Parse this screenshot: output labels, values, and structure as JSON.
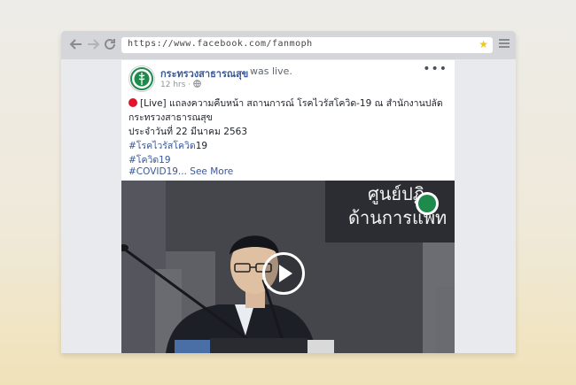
{
  "browser": {
    "url": "https://www.facebook.com/fanmoph",
    "icons": [
      "back-arrow-icon",
      "forward-arrow-icon",
      "reload-icon",
      "bookmark-star-icon",
      "menu-icon"
    ],
    "star_color": "#f2c811"
  },
  "post": {
    "page_name": "กระทรวงสาธารณสุข",
    "status_text": "was live.",
    "time": "12 hrs",
    "more_glyph": "•••",
    "live_prefix": "[Live]",
    "line1_rest": " แถลงความคืบหน้า สถานการณ์ โรคไวรัสโควิด-19 ณ สำนักงานปลัด",
    "line2": "กระทรวงสาธารณสุข",
    "line3": "ประจำวันที่ 22 มีนาคม 2563",
    "hashtags": [
      "#โรคไวรัสโควิด",
      "#โควิด19",
      "#COVID19..."
    ],
    "hashtag1_suffix": "19",
    "see_more": "See More",
    "link_color": "#385898",
    "live_dot_color": "#e0152b",
    "video": {
      "backdrop_text_line1": "ศูนย์ปฏิ",
      "backdrop_text_line2": "ด้านการแพท",
      "play_icon": "play-icon"
    }
  }
}
